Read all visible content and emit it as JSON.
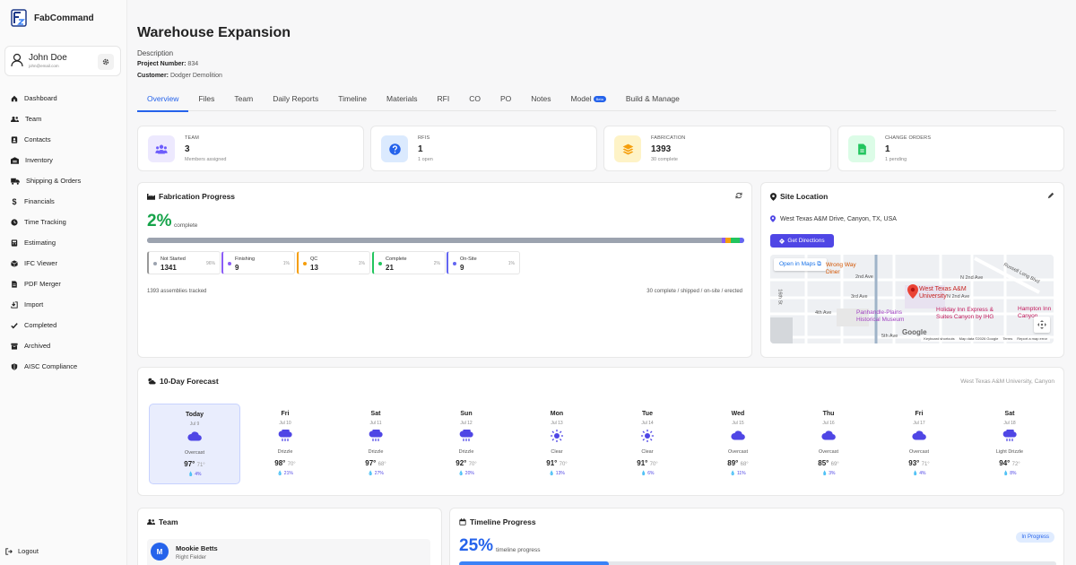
{
  "app": {
    "name": "FabCommand"
  },
  "user": {
    "name": "John Doe",
    "email": "john@email.com"
  },
  "nav": [
    {
      "label": "Dashboard",
      "icon": "home-icon"
    },
    {
      "label": "Team",
      "icon": "users-icon"
    },
    {
      "label": "Contacts",
      "icon": "contact-book-icon"
    },
    {
      "label": "Inventory",
      "icon": "warehouse-icon"
    },
    {
      "label": "Shipping & Orders",
      "icon": "truck-icon"
    },
    {
      "label": "Financials",
      "icon": "dollar-icon"
    },
    {
      "label": "Time Tracking",
      "icon": "clock-icon"
    },
    {
      "label": "Estimating",
      "icon": "calculator-icon"
    },
    {
      "label": "IFC Viewer",
      "icon": "cube-icon"
    },
    {
      "label": "PDF Merger",
      "icon": "file-pdf-icon"
    },
    {
      "label": "Import",
      "icon": "import-icon"
    },
    {
      "label": "Completed",
      "icon": "check-icon"
    },
    {
      "label": "Archived",
      "icon": "archive-icon"
    },
    {
      "label": "AISC Compliance",
      "icon": "shield-icon"
    }
  ],
  "logout_label": "Logout",
  "project": {
    "title": "Warehouse Expansion",
    "description_label": "Description",
    "number_label": "Project Number:",
    "number": "834",
    "customer_label": "Customer:",
    "customer": "Dodger Demolition"
  },
  "tabs": [
    "Overview",
    "Files",
    "Team",
    "Daily Reports",
    "Timeline",
    "Materials",
    "RFI",
    "CO",
    "PO",
    "Notes",
    "Model",
    "Build & Manage"
  ],
  "tab_beta": "Beta",
  "stats": [
    {
      "label": "TEAM",
      "value": "3",
      "sub": "Members assigned",
      "icon": "users-icon",
      "bg": "#ede9fe",
      "fg": "#6d5dfc"
    },
    {
      "label": "RFIS",
      "value": "1",
      "sub": "1 open",
      "icon": "question-icon",
      "bg": "#dbeafe",
      "fg": "#2563eb"
    },
    {
      "label": "FABRICATION",
      "value": "1393",
      "sub": "30 complete",
      "icon": "layers-icon",
      "bg": "#fef3c7",
      "fg": "#f59e0b"
    },
    {
      "label": "CHANGE ORDERS",
      "value": "1",
      "sub": "1 pending",
      "icon": "document-icon",
      "bg": "#dcfce7",
      "fg": "#22c55e"
    }
  ],
  "fabrication": {
    "title": "Fabrication Progress",
    "percent": "2%",
    "percent_label": "complete",
    "stages": [
      {
        "label": "Not Started",
        "value": "1341",
        "pct": "96%",
        "color": "#9ca3af",
        "fraction": 0.963
      },
      {
        "label": "Finishing",
        "value": "9",
        "pct": "1%",
        "color": "#8b5cf6",
        "fraction": 0.0065
      },
      {
        "label": "QC",
        "value": "13",
        "pct": "1%",
        "color": "#f59e0b",
        "fraction": 0.0093
      },
      {
        "label": "Complete",
        "value": "21",
        "pct": "2%",
        "color": "#22c55e",
        "fraction": 0.015
      },
      {
        "label": "On-Site",
        "value": "9",
        "pct": "1%",
        "color": "#6366f1",
        "fraction": 0.0065
      }
    ],
    "tracked": "1393 assemblies tracked",
    "summary": "30 complete / shipped / on-site / erected"
  },
  "site": {
    "title": "Site Location",
    "address": "West Texas A&M Drive, Canyon, TX, USA",
    "directions": "Get Directions",
    "map": {
      "open_in_maps": "Open in Maps",
      "poi_university": "West Texas A&M University",
      "poi_museum": "Panhandle-Plains Historical Museum",
      "poi_hotel1": "Holiday Inn Express & Suites Canyon by IHG",
      "poi_hotel2": "Hampton Inn Canyon",
      "poi_diner": "Wrong Way Diner",
      "streets": [
        "2nd Ave",
        "3rd Ave",
        "4th Ave",
        "N 2nd Ave",
        "N 2nd Ave",
        "Russell Long Blvd",
        "16th St",
        "5th Ave"
      ],
      "google": "Google",
      "attribution": [
        "Keyboard shortcuts",
        "Map data ©2026 Google",
        "Terms",
        "Report a map error"
      ]
    }
  },
  "forecast": {
    "title": "10-Day Forecast",
    "location": "West Texas A&M University, Canyon",
    "days": [
      {
        "name": "Today",
        "date": "Jul 9",
        "cond": "Overcast",
        "icon": "cloud-icon",
        "hi": "97°",
        "lo": "71°",
        "precip": "4%"
      },
      {
        "name": "Fri",
        "date": "Jul 10",
        "cond": "Drizzle",
        "icon": "drizzle-icon",
        "hi": "98°",
        "lo": "70°",
        "precip": "21%"
      },
      {
        "name": "Sat",
        "date": "Jul 11",
        "cond": "Drizzle",
        "icon": "drizzle-icon",
        "hi": "97°",
        "lo": "68°",
        "precip": "27%"
      },
      {
        "name": "Sun",
        "date": "Jul 12",
        "cond": "Drizzle",
        "icon": "drizzle-icon",
        "hi": "92°",
        "lo": "70°",
        "precip": "20%"
      },
      {
        "name": "Mon",
        "date": "Jul 13",
        "cond": "Clear",
        "icon": "sun-icon",
        "hi": "91°",
        "lo": "70°",
        "precip": "13%"
      },
      {
        "name": "Tue",
        "date": "Jul 14",
        "cond": "Clear",
        "icon": "sun-icon",
        "hi": "91°",
        "lo": "70°",
        "precip": "6%"
      },
      {
        "name": "Wed",
        "date": "Jul 15",
        "cond": "Overcast",
        "icon": "cloud-icon",
        "hi": "89°",
        "lo": "68°",
        "precip": "11%"
      },
      {
        "name": "Thu",
        "date": "Jul 16",
        "cond": "Overcast",
        "icon": "cloud-icon",
        "hi": "85°",
        "lo": "69°",
        "precip": "3%"
      },
      {
        "name": "Fri",
        "date": "Jul 17",
        "cond": "Overcast",
        "icon": "cloud-icon",
        "hi": "93°",
        "lo": "71°",
        "precip": "4%"
      },
      {
        "name": "Sat",
        "date": "Jul 18",
        "cond": "Light Drizzle",
        "icon": "drizzle-icon",
        "hi": "94°",
        "lo": "72°",
        "precip": "8%"
      }
    ]
  },
  "team": {
    "title": "Team",
    "members": [
      {
        "initial": "M",
        "name": "Mookie Betts",
        "role": "Right Fielder"
      }
    ]
  },
  "timeline": {
    "title": "Timeline Progress",
    "percent": "25%",
    "percent_label": "timeline progress",
    "progress": 0.25,
    "status": "In Progress"
  }
}
